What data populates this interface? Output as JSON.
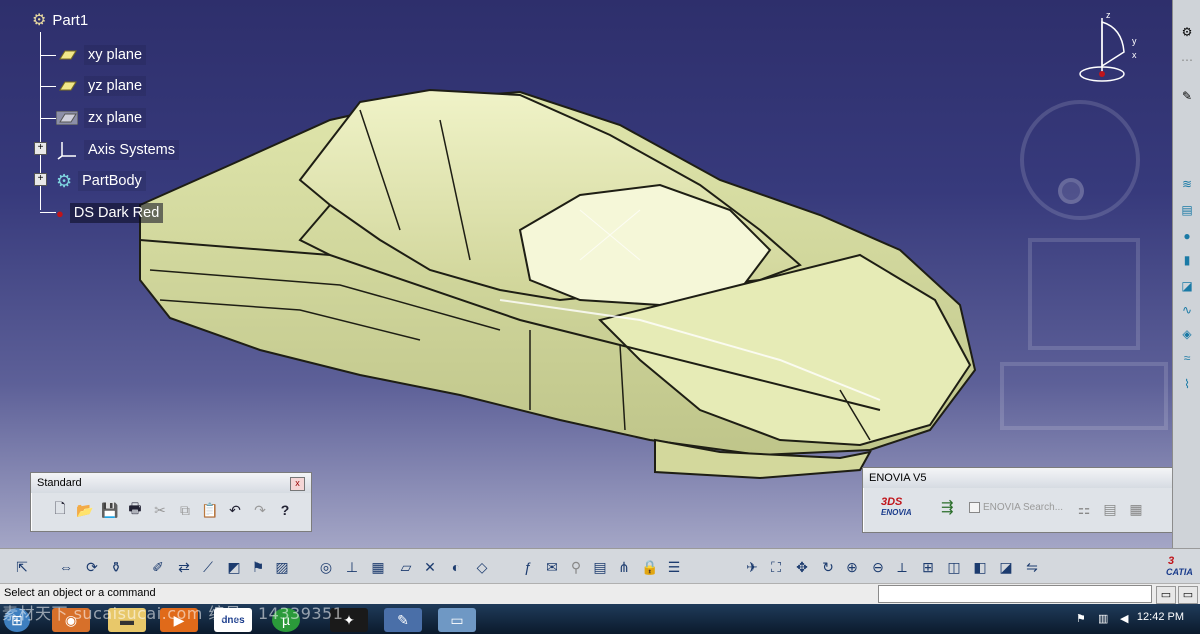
{
  "tree": {
    "root": "Part1",
    "items": [
      {
        "label": "xy plane",
        "icon": "plane-icon"
      },
      {
        "label": "yz plane",
        "icon": "plane-icon"
      },
      {
        "label": "zx plane",
        "icon": "plane-icon"
      },
      {
        "label": "Axis Systems",
        "icon": "axis-icon"
      },
      {
        "label": "PartBody",
        "icon": "gear-icon"
      },
      {
        "label": "DS Dark Red",
        "icon": "material-icon"
      }
    ]
  },
  "compass": {
    "x_label": "x",
    "y_label": "y",
    "z_label": "z"
  },
  "standard_toolbar": {
    "title": "Standard",
    "close": "x",
    "tools": [
      {
        "name": "new-icon",
        "glyph": "🗋"
      },
      {
        "name": "open-icon",
        "glyph": "📂"
      },
      {
        "name": "save-icon",
        "glyph": "💾"
      },
      {
        "name": "print-icon",
        "glyph": "🖶"
      },
      {
        "name": "cut-icon",
        "glyph": "✂"
      },
      {
        "name": "copy-icon",
        "glyph": "⧉"
      },
      {
        "name": "paste-icon",
        "glyph": "📋"
      },
      {
        "name": "undo-icon",
        "glyph": "↶"
      },
      {
        "name": "redo-icon",
        "glyph": "↷"
      },
      {
        "name": "help-icon",
        "glyph": "?"
      }
    ]
  },
  "enovia_toolbar": {
    "title": "ENOVIA V5",
    "logo_line1": "3DS",
    "logo_line2": "ENOVIA",
    "search_placeholder": "ENOVIA Search..."
  },
  "status": {
    "message": "Select an object or a command"
  },
  "brand": {
    "catia": "CATIA"
  },
  "taskbar": {
    "time": "12:42 PM",
    "app_label": "dnes"
  },
  "watermark": "素材天下 sucaisucai.com    编号：14339351",
  "colors": {
    "viewport_top": "#2e2f6c",
    "model": "#e4e9b4",
    "panel": "#dfe3e8"
  }
}
